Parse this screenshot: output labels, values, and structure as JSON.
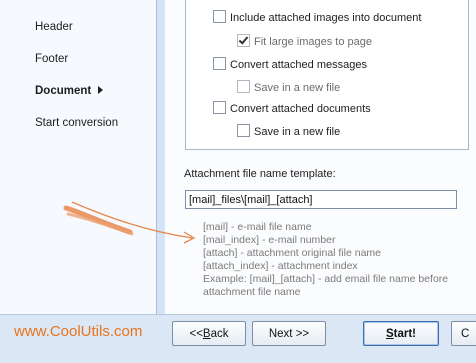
{
  "sidebar": {
    "items": [
      {
        "label": "Header"
      },
      {
        "label": "Footer"
      },
      {
        "label": "Document",
        "active": true
      },
      {
        "label": "Start conversion"
      }
    ]
  },
  "options": {
    "include_images": {
      "label": "Include attached images into document",
      "checked": false
    },
    "fit_images": {
      "label": "Fit large images to page",
      "checked": true
    },
    "convert_messages": {
      "label": "Convert attached messages",
      "checked": false
    },
    "save_new_file_1": {
      "label": "Save in a new file",
      "checked": false
    },
    "convert_documents": {
      "label": "Convert attached documents",
      "checked": false
    },
    "save_new_file_2": {
      "label": "Save in a new file",
      "checked": false
    }
  },
  "template": {
    "label": "Attachment file name template:",
    "value": "[mail]_files\\[mail]_[attach]"
  },
  "help": {
    "lines": [
      "[mail] - e-mail file name",
      "[mail_index] - e-mail number",
      "[attach] - attachment original file name",
      "[attach_index] - attachment index",
      "Example: [mail]_[attach] - add email file name before attachment file name"
    ]
  },
  "footer": {
    "brand": "www.CoolUtils.com",
    "back_prefix": "<< ",
    "back_mnemonic": "B",
    "back_rest": "ack",
    "next_label": "Next >>",
    "start_mnemonic": "S",
    "start_rest": "tart!",
    "cancel_partial": "C"
  },
  "colors": {
    "brand": "#e8741c",
    "panel_bg": "#d4e3f5",
    "help_text": "#7b7b7b",
    "annotation": "#e8874a"
  }
}
